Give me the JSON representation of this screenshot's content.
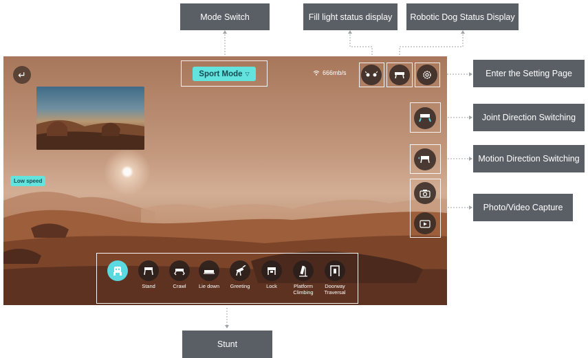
{
  "callouts": {
    "mode_switch": "Mode Switch",
    "fill_light": "Fill light status display",
    "dog_status": "Robotic Dog Status Display",
    "settings": "Enter the Setting Page",
    "joint_dir": "Joint Direction Switching",
    "motion_dir": "Motion Direction Switching",
    "capture": "Photo/Video Capture",
    "stunt": "Stunt"
  },
  "app": {
    "mode_label": "Sport Mode",
    "speed_badge": "Low speed",
    "network_speed": "666mb/s",
    "stunts": [
      {
        "label": ""
      },
      {
        "label": "Stand"
      },
      {
        "label": "Crawl"
      },
      {
        "label": "Lie down"
      },
      {
        "label": "Greeting"
      },
      {
        "label": "Lock"
      },
      {
        "label": "Platform Climbing"
      },
      {
        "label": "Doorway Traversal"
      }
    ]
  },
  "colors": {
    "accent": "#63e3de",
    "callout_bg": "#5a5f66"
  }
}
